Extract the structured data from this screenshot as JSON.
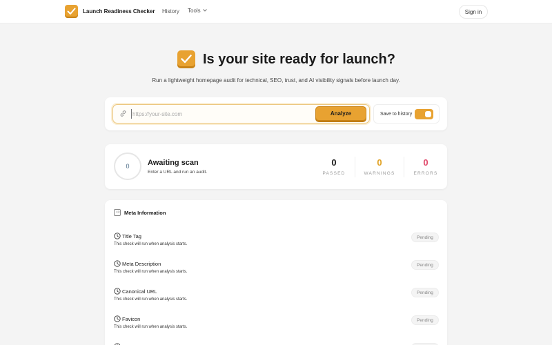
{
  "nav": {
    "brand": "Launch Readiness Checker",
    "history": "History",
    "tools": "Tools",
    "signin": "Sign in"
  },
  "hero": {
    "title": "Is your site ready for launch?",
    "subtitle": "Run a lightweight homepage audit for technical, SEO, trust, and AI visibility signals before launch day."
  },
  "form": {
    "url_value": "",
    "url_placeholder": "https://your-site.com",
    "analyze_label": "Analyze",
    "save_history_label": "Save to history",
    "save_history_on": true
  },
  "status": {
    "score": "0",
    "title": "Awaiting scan",
    "subtitle": "Enter a URL and run an audit.",
    "passed": {
      "value": "0",
      "label": "PASSED"
    },
    "warnings": {
      "value": "0",
      "label": "WARNINGS"
    },
    "errors": {
      "value": "0",
      "label": "ERRORS"
    }
  },
  "meta": {
    "section_title": "Meta Information",
    "checks": [
      {
        "name": "Title Tag",
        "desc": "This check will run when analysis starts.",
        "status": "Pending"
      },
      {
        "name": "Meta Description",
        "desc": "This check will run when analysis starts.",
        "status": "Pending"
      },
      {
        "name": "Canonical URL",
        "desc": "This check will run when analysis starts.",
        "status": "Pending"
      },
      {
        "name": "Favicon",
        "desc": "This check will run when analysis starts.",
        "status": "Pending"
      },
      {
        "name": "",
        "desc": "",
        "status": ""
      }
    ]
  },
  "colors": {
    "accent": "#e8a231",
    "passed": "#1c1c1c",
    "warnings": "#e0a020",
    "errors": "#e0486a"
  }
}
